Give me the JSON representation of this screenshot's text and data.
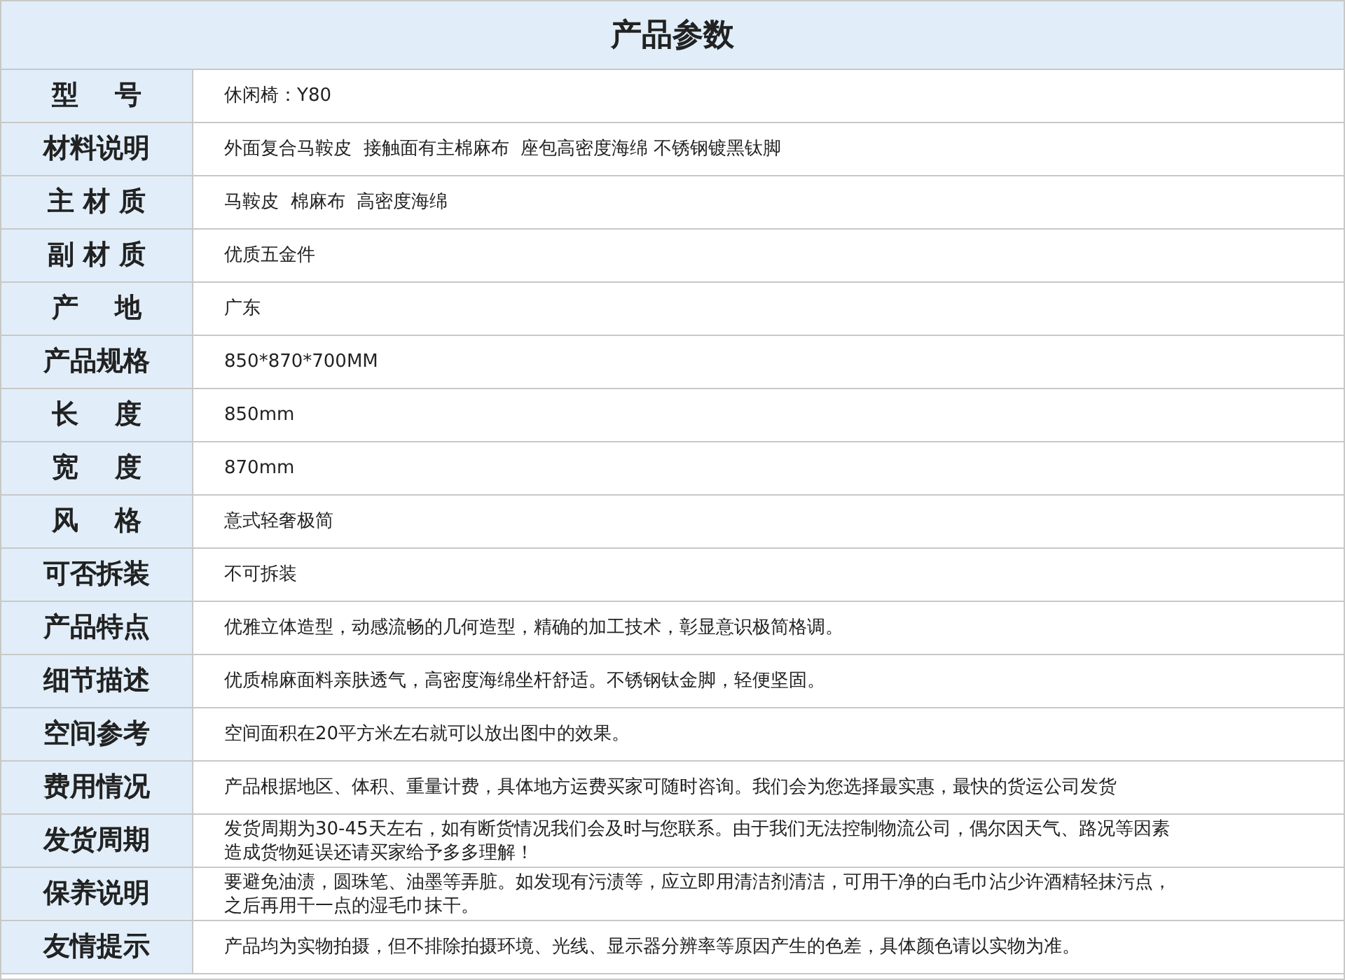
{
  "title": "产品参数",
  "rows": [
    {
      "label": "型    号",
      "lines": [
        "休闲椅：Y80"
      ]
    },
    {
      "label": "材料说明",
      "lines": [
        "外面复合马鞍皮  接触面有主棉麻布  座包高密度海绵 不锈钢镀黑钛脚"
      ]
    },
    {
      "label": "主 材 质",
      "lines": [
        "马鞍皮  棉麻布  高密度海绵"
      ]
    },
    {
      "label": "副 材 质",
      "lines": [
        "优质五金件"
      ]
    },
    {
      "label": "产    地",
      "lines": [
        "广东"
      ]
    },
    {
      "label": "产品规格",
      "lines": [
        "850*870*700MM"
      ]
    },
    {
      "label": "长    度",
      "lines": [
        "850mm"
      ]
    },
    {
      "label": "宽    度",
      "lines": [
        "870mm"
      ]
    },
    {
      "label": "风    格",
      "lines": [
        "意式轻奢极简"
      ]
    },
    {
      "label": "可否拆装",
      "lines": [
        "不可拆装"
      ]
    },
    {
      "label": "产品特点",
      "lines": [
        "优雅立体造型，动感流畅的几何造型，精确的加工技术，彰显意识极简格调。"
      ]
    },
    {
      "label": "细节描述",
      "lines": [
        "优质棉麻面料亲肤透气，高密度海绵坐杆舒适。不锈钢钛金脚，轻便坚固。"
      ]
    },
    {
      "label": "空间参考",
      "lines": [
        "空间面积在20平方米左右就可以放出图中的效果。"
      ]
    },
    {
      "label": "费用情况",
      "lines": [
        "产品根据地区、体积、重量计费，具体地方运费买家可随时咨询。我们会为您选择最实惠，最快的货运公司发货"
      ]
    },
    {
      "label": "发货周期",
      "lines": [
        "发货周期为30-45天左右，如有断货情况我们会及时与您联系。由于我们无法控制物流公司，偶尔因天气、路况等因素",
        "造成货物延误还请买家给予多多理解！"
      ]
    },
    {
      "label": "保养说明",
      "lines": [
        "要避免油渍，圆珠笔、油墨等弄脏。如发现有污渍等，应立即用清洁剂清洁，可用干净的白毛巾沾少许酒精轻抹污点，",
        "之后再用干一点的湿毛巾抹干。"
      ]
    },
    {
      "label": "友情提示",
      "lines": [
        "产品均为实物拍摄，但不排除拍摄环境、光线、显示器分辨率等原因产生的色差，具体颜色请以实物为准。"
      ]
    }
  ]
}
